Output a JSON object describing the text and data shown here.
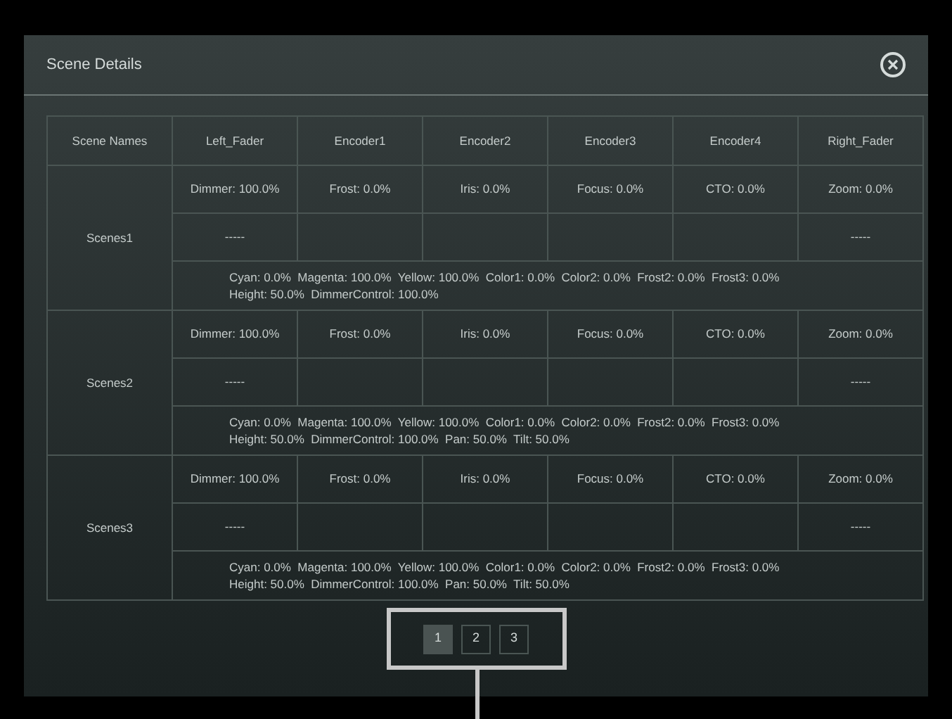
{
  "dialog": {
    "title": "Scene Details"
  },
  "table": {
    "columns": [
      "Scene Names",
      "Left_Fader",
      "Encoder1",
      "Encoder2",
      "Encoder3",
      "Encoder4",
      "Right_Fader"
    ],
    "rows": [
      {
        "name": "Scenes1",
        "values": [
          "Dimmer: 100.0%",
          "Frost: 0.0%",
          "Iris: 0.0%",
          "Focus: 0.0%",
          "CTO: 0.0%",
          "Zoom: 0.0%"
        ],
        "second": {
          "left_fader": "-----",
          "right_fader": "-----"
        },
        "summary_lines": [
          "Cyan: 0.0%  Magenta: 100.0%  Yellow: 100.0%  Color1: 0.0%  Color2: 0.0%  Frost2: 0.0%  Frost3: 0.0%",
          "Height: 50.0%  DimmerControl: 100.0%"
        ]
      },
      {
        "name": "Scenes2",
        "values": [
          "Dimmer: 100.0%",
          "Frost: 0.0%",
          "Iris: 0.0%",
          "Focus: 0.0%",
          "CTO: 0.0%",
          "Zoom: 0.0%"
        ],
        "second": {
          "left_fader": "-----",
          "right_fader": "-----"
        },
        "summary_lines": [
          "Cyan: 0.0%  Magenta: 100.0%  Yellow: 100.0%  Color1: 0.0%  Color2: 0.0%  Frost2: 0.0%  Frost3: 0.0%",
          "Height: 50.0%  DimmerControl: 100.0%  Pan: 50.0%  Tilt: 50.0%"
        ]
      },
      {
        "name": "Scenes3",
        "values": [
          "Dimmer: 100.0%",
          "Frost: 0.0%",
          "Iris: 0.0%",
          "Focus: 0.0%",
          "CTO: 0.0%",
          "Zoom: 0.0%"
        ],
        "second": {
          "left_fader": "-----",
          "right_fader": "-----"
        },
        "summary_lines": [
          "Cyan: 0.0%  Magenta: 100.0%  Yellow: 100.0%  Color1: 0.0%  Color2: 0.0%  Frost2: 0.0%  Frost3: 0.0%",
          "Height: 50.0%  DimmerControl: 100.0%  Pan: 50.0%  Tilt: 50.0%"
        ]
      }
    ]
  },
  "pagination": {
    "highlighted": true,
    "pages": [
      {
        "label": "1",
        "selected": true
      },
      {
        "label": "2",
        "selected": false
      },
      {
        "label": "3",
        "selected": false
      }
    ]
  }
}
